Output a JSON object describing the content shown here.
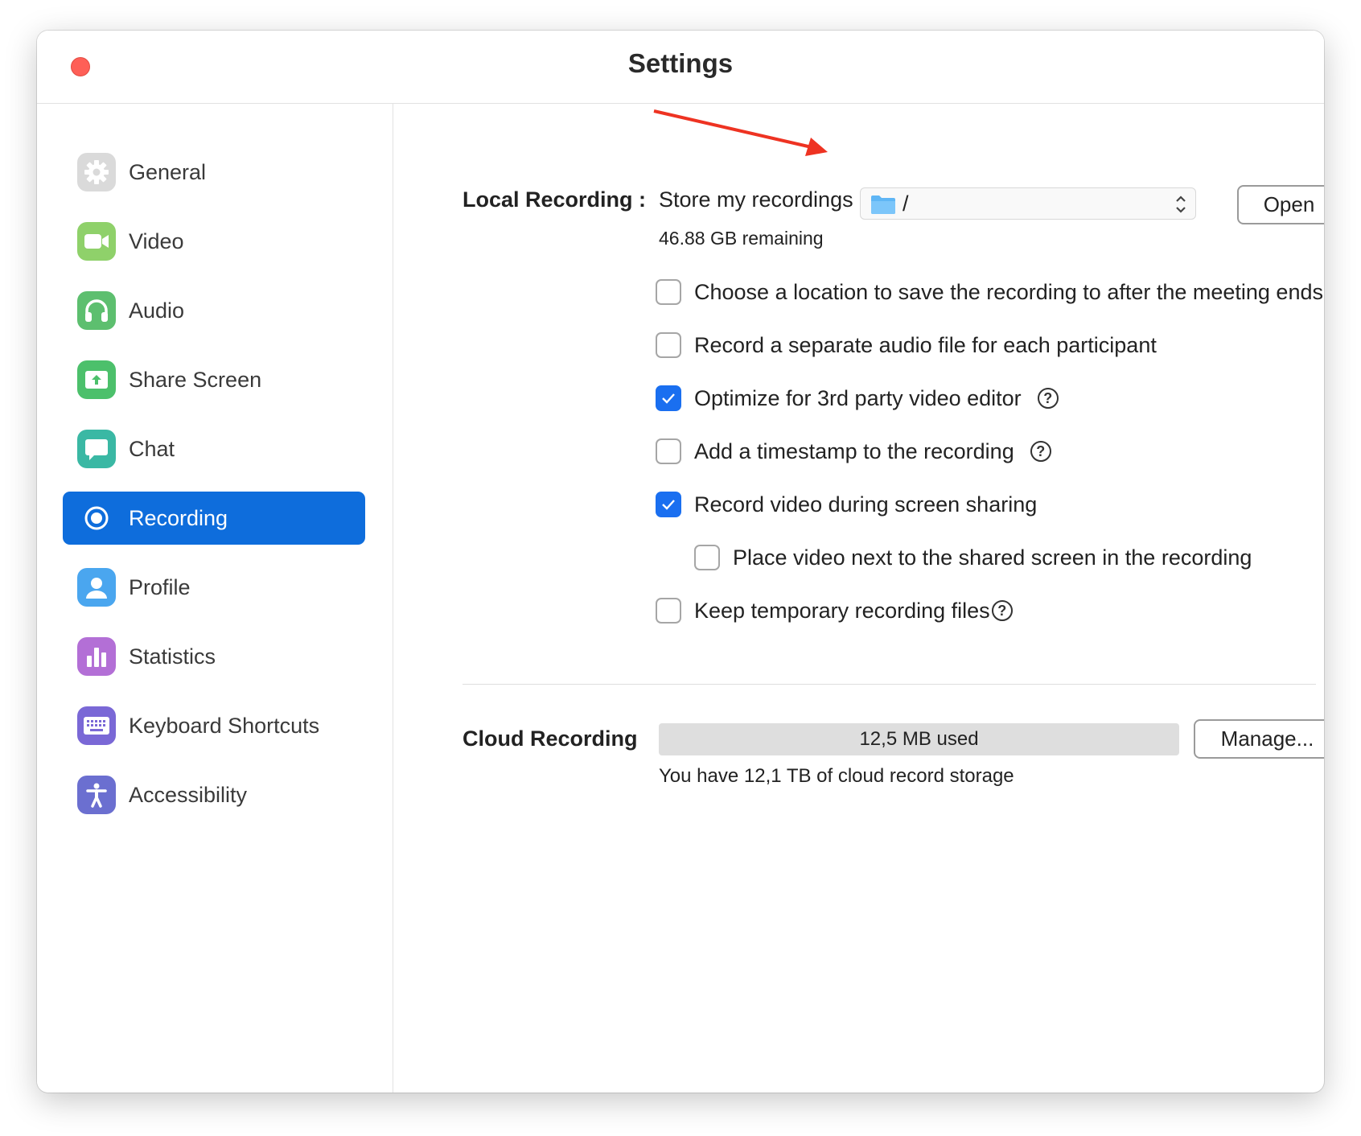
{
  "window": {
    "title": "Settings"
  },
  "sidebar": {
    "items": [
      {
        "id": "general",
        "label": "General",
        "icon": "gear-icon",
        "color": "#d7d7d7"
      },
      {
        "id": "video",
        "label": "Video",
        "icon": "video-camera-icon",
        "color": "#8fd16a"
      },
      {
        "id": "audio",
        "label": "Audio",
        "icon": "headphones-icon",
        "color": "#5dbf6f"
      },
      {
        "id": "share-screen",
        "label": "Share Screen",
        "icon": "share-screen-icon",
        "color": "#4cc06b"
      },
      {
        "id": "chat",
        "label": "Chat",
        "icon": "chat-bubble-icon",
        "color": "#3ab8a4"
      },
      {
        "id": "recording",
        "label": "Recording",
        "icon": "record-icon",
        "color": "#0e6ddc",
        "active": true
      },
      {
        "id": "profile",
        "label": "Profile",
        "icon": "person-icon",
        "color": "#4aa6ef"
      },
      {
        "id": "statistics",
        "label": "Statistics",
        "icon": "bar-chart-icon",
        "color": "#b36fd6"
      },
      {
        "id": "keyboard-shortcuts",
        "label": "Keyboard Shortcuts",
        "icon": "keyboard-icon",
        "color": "#7a68d6"
      },
      {
        "id": "accessibility",
        "label": "Accessibility",
        "icon": "accessibility-icon",
        "color": "#6b6fd0"
      }
    ]
  },
  "local_recording": {
    "label": "Local Recording :",
    "store_label": "Store my recordings at:",
    "path": "/",
    "open_button": "Open",
    "remaining": "46.88 GB remaining",
    "options": [
      {
        "id": "choose-location",
        "label": "Choose a location to save the recording to after the meeting ends",
        "checked": false,
        "help": false,
        "indent": false
      },
      {
        "id": "separate-audio",
        "label": "Record a separate audio file for each participant",
        "checked": false,
        "help": false,
        "indent": false
      },
      {
        "id": "optimize-editor",
        "label": "Optimize for 3rd party video editor",
        "checked": true,
        "help": true,
        "indent": false
      },
      {
        "id": "timestamp",
        "label": "Add a timestamp to the recording",
        "checked": false,
        "help": true,
        "indent": false
      },
      {
        "id": "record-video-sharing",
        "label": "Record video during screen sharing",
        "checked": true,
        "help": false,
        "indent": false
      },
      {
        "id": "place-video-next",
        "label": "Place video next to the shared screen in the recording",
        "checked": false,
        "help": false,
        "indent": true
      },
      {
        "id": "keep-temp-files",
        "label": "Keep temporary recording files",
        "checked": false,
        "help": true,
        "indent": false,
        "help_tight": true
      }
    ]
  },
  "cloud_recording": {
    "label": "Cloud Recording",
    "usage": "12,5 MB used",
    "manage_button": "Manage...",
    "storage_note": "You have 12,1 TB of cloud record storage"
  },
  "annotation": {
    "arrow_color": "#ee3322"
  },
  "colors": {
    "accent": "#0e6ddc",
    "checkbox_checked": "#1a6ff0",
    "close_button": "#fe5f57"
  }
}
